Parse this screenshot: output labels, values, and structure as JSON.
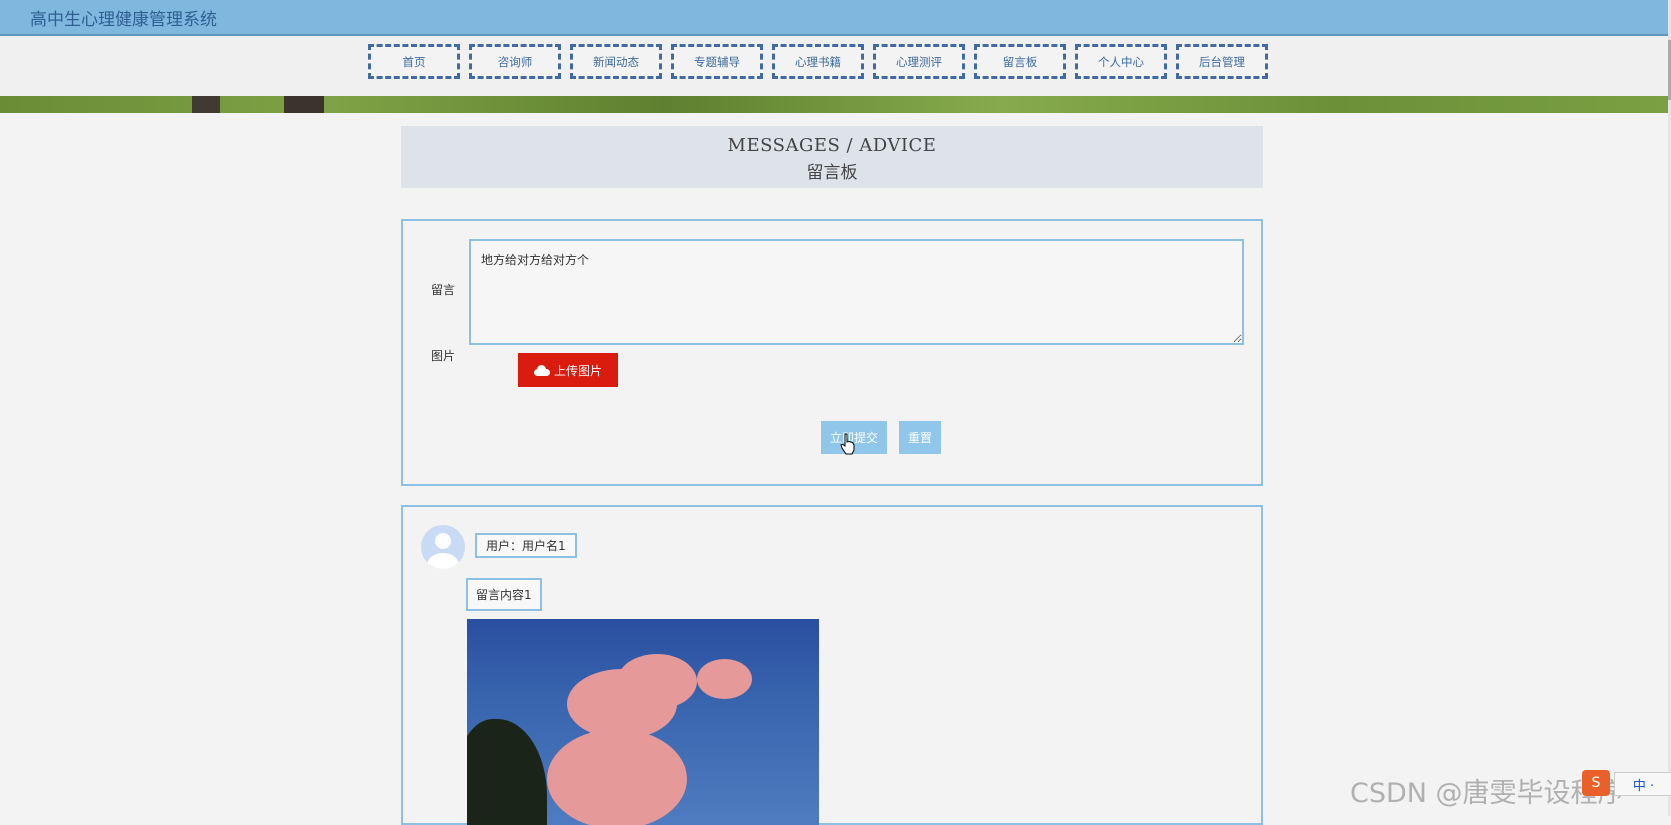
{
  "header": {
    "site_title": "高中生心理健康管理系统"
  },
  "nav": {
    "items": [
      "首页",
      "咨询师",
      "新闻动态",
      "专题辅导",
      "心理书籍",
      "心理测评",
      "留言板",
      "个人中心",
      "后台管理"
    ]
  },
  "page": {
    "heading_en": "MESSAGES / ADVICE",
    "heading_cn": "留言板"
  },
  "form": {
    "message_label": "留言",
    "message_value": "地方给对方给对方个",
    "image_label": "图片",
    "upload_label": "上传图片",
    "submit_label": "立即提交",
    "reset_label": "重置"
  },
  "messages": [
    {
      "user": "用户：用户名1",
      "content": "留言内容1"
    }
  ],
  "overlay": {
    "watermark": "CSDN @唐雯毕设程序",
    "ime_logo": "S",
    "ime_status": "中 ·"
  },
  "colors": {
    "topbar": "#7fb8de",
    "nav_border": "#3f6aa3",
    "upload_button": "#da1c0f",
    "action_button": "#90c6e9",
    "box_border": "#8dc1e3"
  },
  "icons": [
    "cloud-upload-icon",
    "user-avatar-icon",
    "pointer-cursor-icon"
  ]
}
